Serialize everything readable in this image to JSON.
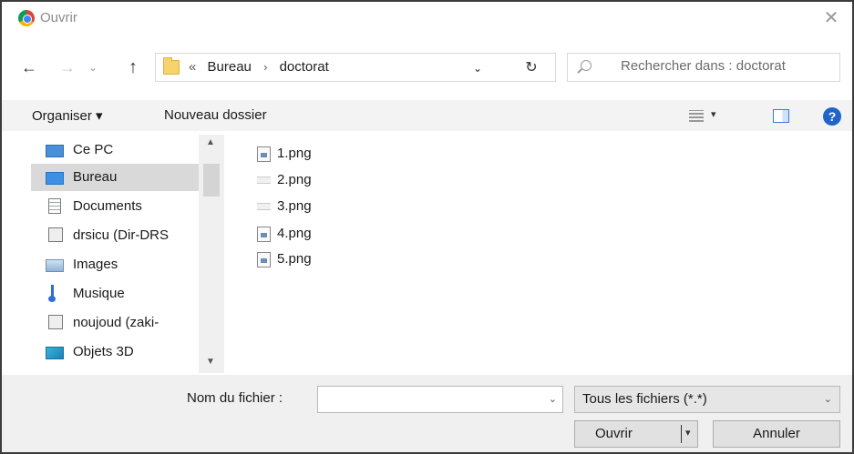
{
  "window": {
    "title": "Ouvrir",
    "close_glyph": "✕"
  },
  "nav": {
    "back_glyph": "←",
    "forward_glyph": "→",
    "recent_glyph": "⌄",
    "up_glyph": "↑",
    "address": {
      "overflow": "«",
      "crumbs": [
        "Bureau",
        "doctorat"
      ],
      "separator": "›"
    },
    "dropdown_glyph": "⌄",
    "refresh_glyph": "↻",
    "search_placeholder": "Rechercher dans : doctorat"
  },
  "toolbar": {
    "organize_label": "Organiser ▾",
    "new_folder_label": "Nouveau dossier",
    "view_dropdown_glyph": "▾",
    "help_glyph": "?"
  },
  "sidebar": {
    "items": [
      {
        "label": "Ce PC",
        "icon": "computer-icon"
      },
      {
        "label": "Bureau",
        "icon": "desktop-icon",
        "selected": true
      },
      {
        "label": "Documents",
        "icon": "documents-icon"
      },
      {
        "label": "drsicu (Dir-DRS",
        "icon": "network-drive-icon"
      },
      {
        "label": "Images",
        "icon": "pictures-icon"
      },
      {
        "label": "Musique",
        "icon": "music-icon"
      },
      {
        "label": "noujoud (zaki-",
        "icon": "network-drive-icon"
      },
      {
        "label": "Objets 3D",
        "icon": "3d-objects-icon"
      }
    ],
    "scroll_up": "▲",
    "scroll_down": "▼"
  },
  "files": [
    {
      "name": "1.png"
    },
    {
      "name": "2.png"
    },
    {
      "name": "3.png"
    },
    {
      "name": "4.png"
    },
    {
      "name": "5.png"
    }
  ],
  "bottom": {
    "filename_label": "Nom du fichier :",
    "filename_value": "",
    "dropdown_glyph": "⌄",
    "filter_label": "Tous les fichiers (*.*)",
    "open_label": "Ouvrir",
    "open_dropdown_glyph": "▾",
    "cancel_label": "Annuler"
  }
}
